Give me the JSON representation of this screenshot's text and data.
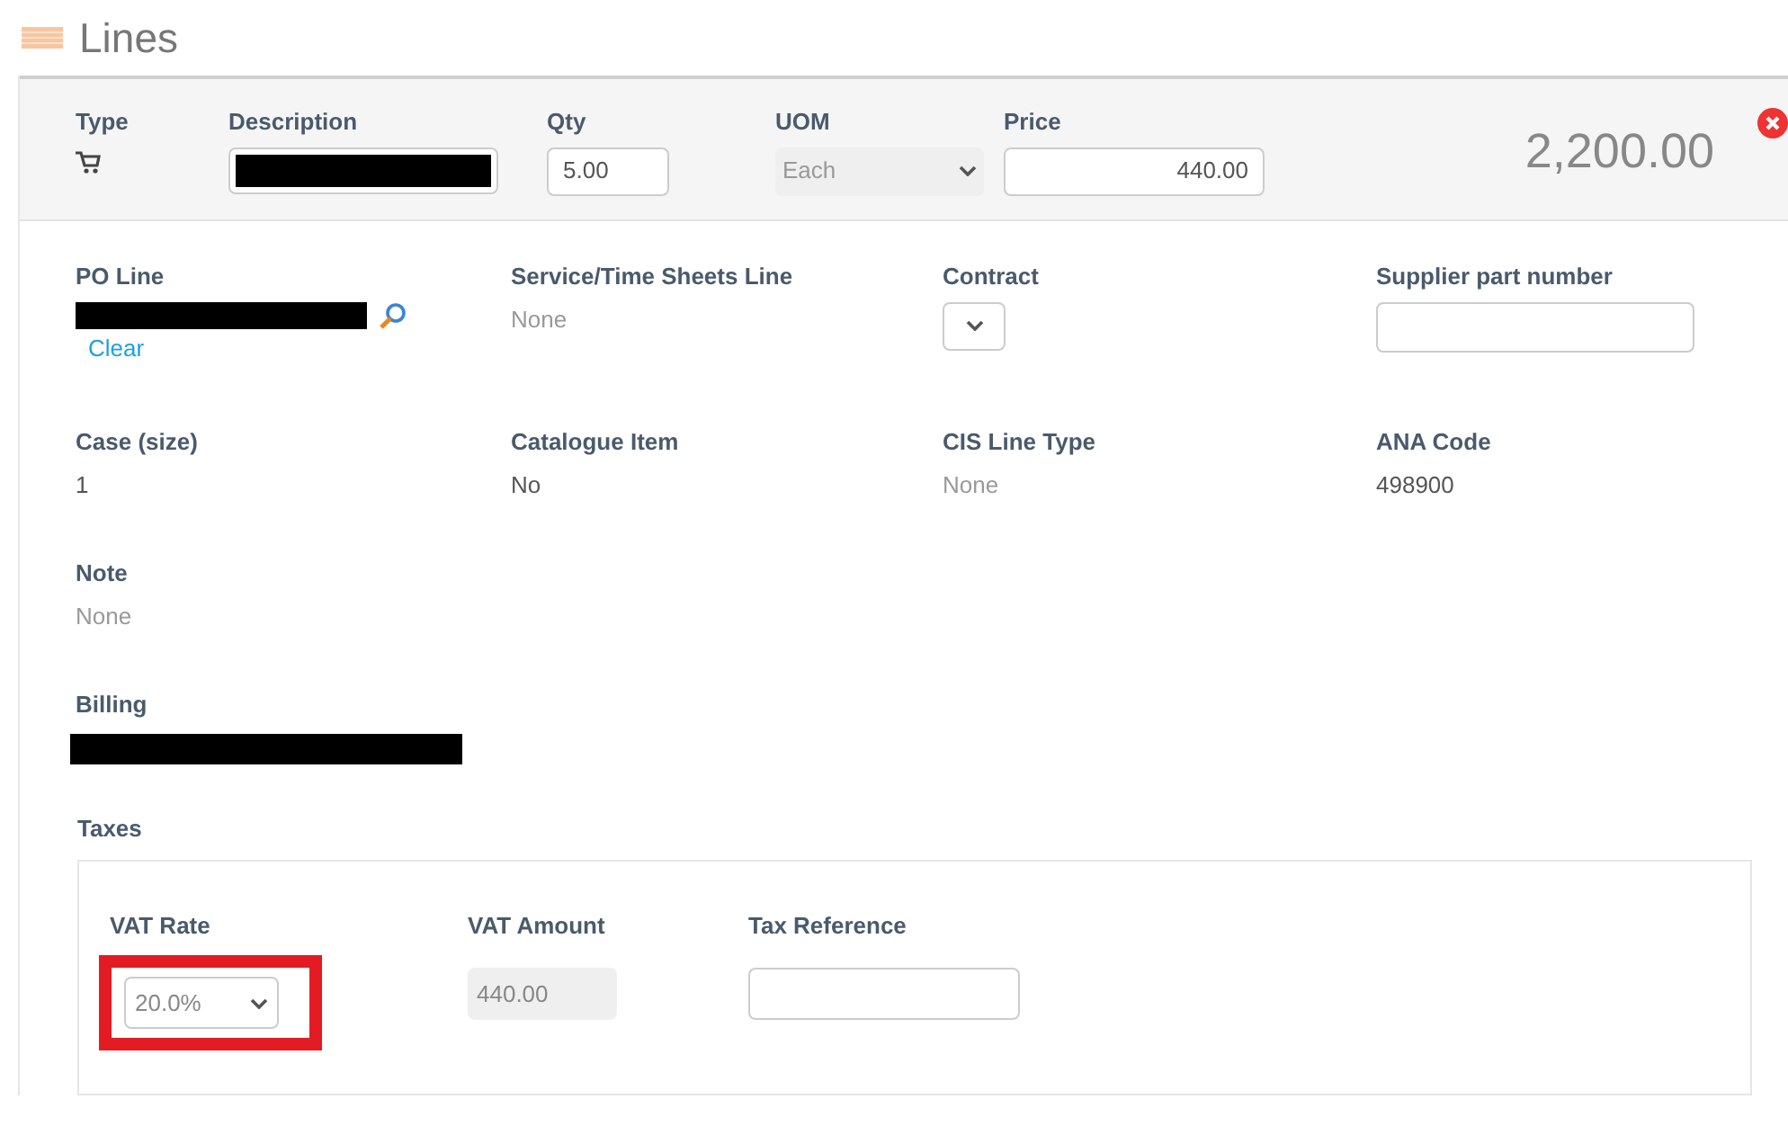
{
  "section": {
    "title": "Lines"
  },
  "line_header": {
    "columns": [
      {
        "label": "Type",
        "kind": "icon"
      },
      {
        "label": "Description",
        "kind": "redacted_input"
      },
      {
        "label": "Qty",
        "kind": "input",
        "value": "5.00"
      },
      {
        "label": "UOM",
        "kind": "select",
        "value": "Each",
        "disabled": true
      },
      {
        "label": "Price",
        "kind": "input",
        "value": "440.00"
      }
    ],
    "total": "2,200.00"
  },
  "fields": [
    {
      "label": "PO Line",
      "kind": "lookup",
      "link": "Clear"
    },
    {
      "label": "Service/Time Sheets Line",
      "kind": "text",
      "value": "None",
      "dimmed": true
    },
    {
      "label": "Contract",
      "kind": "select"
    },
    {
      "label": "Supplier part number",
      "kind": "input"
    },
    {
      "label": "Case (size)",
      "kind": "text",
      "value": "1",
      "dimmed": false
    },
    {
      "label": "Catalogue Item",
      "kind": "text",
      "value": "No",
      "dimmed": false
    },
    {
      "label": "CIS Line Type",
      "kind": "text",
      "value": "None",
      "dimmed": true
    },
    {
      "label": "ANA Code",
      "kind": "text",
      "value": "498900",
      "dimmed": false
    },
    {
      "label": "Note",
      "kind": "text",
      "value": "None",
      "dimmed": true
    },
    {
      "label": "Billing",
      "kind": "redacted"
    }
  ],
  "taxes": {
    "title": "Taxes",
    "fields": [
      {
        "label": "VAT Rate",
        "kind": "select",
        "value": "20.0%",
        "highlighted": true
      },
      {
        "label": "VAT Amount",
        "kind": "readonly",
        "value": "440.00",
        "highlighted": false
      },
      {
        "label": "Tax Reference",
        "kind": "input",
        "highlighted": false
      }
    ]
  }
}
